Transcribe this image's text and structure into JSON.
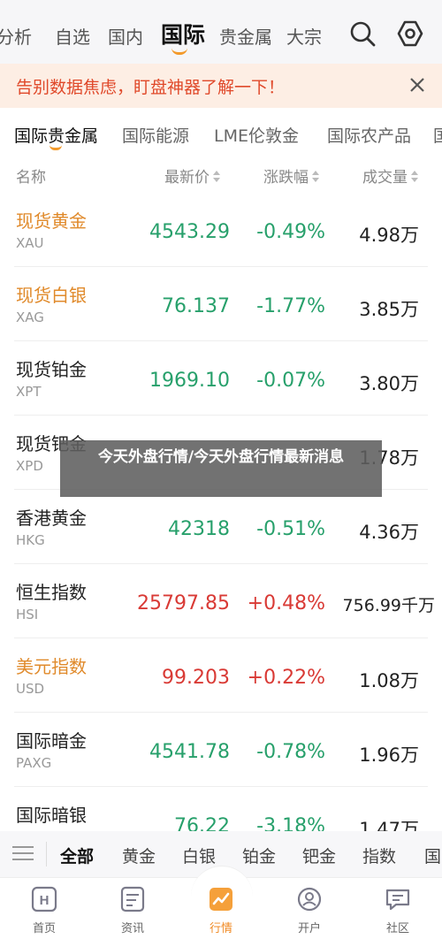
{
  "topnav": {
    "tabs": [
      "分析",
      "自选",
      "国内",
      "国际",
      "贵金属",
      "大宗"
    ],
    "active_tab": "国际",
    "accent_color": "#f39a2b"
  },
  "banner": {
    "text": "告别数据焦虑，盯盘神器了解一下！",
    "text_color": "#e0492a"
  },
  "categories": {
    "tabs": [
      "国际贵金属",
      "国际能源",
      "LME伦敦金",
      "国际农产品",
      "国"
    ],
    "active": "国际贵金属"
  },
  "columns": {
    "name": "名称",
    "price": "最新价",
    "change": "涨跌幅",
    "volume": "成交量"
  },
  "rows": [
    {
      "name": "现货黄金",
      "code": "XAU",
      "price": "4543.29",
      "change": "-0.49%",
      "volume": "4.98万",
      "name_color": "gold",
      "dir": "down"
    },
    {
      "name": "现货白银",
      "code": "XAG",
      "price": "76.137",
      "change": "-1.77%",
      "volume": "3.85万",
      "name_color": "gold",
      "dir": "down"
    },
    {
      "name": "现货铂金",
      "code": "XPT",
      "price": "1969.10",
      "change": "-0.07%",
      "volume": "3.80万",
      "name_color": "normal",
      "dir": "down"
    },
    {
      "name": "现货钯金",
      "code": "XPD",
      "price": "",
      "change": "",
      "volume": "1.78万",
      "name_color": "normal",
      "dir": "down"
    },
    {
      "name": "香港黄金",
      "code": "HKG",
      "price": "42318",
      "change": "-0.51%",
      "volume": "4.36万",
      "name_color": "normal",
      "dir": "down"
    },
    {
      "name": "恒生指数",
      "code": "HSI",
      "price": "25797.85",
      "change": "+0.48%",
      "volume": "756.99千万",
      "name_color": "normal",
      "dir": "up"
    },
    {
      "name": "美元指数",
      "code": "USD",
      "price": "99.203",
      "change": "+0.22%",
      "volume": "1.08万",
      "name_color": "gold",
      "dir": "up"
    },
    {
      "name": "国际暗金",
      "code": "PAXG",
      "price": "4541.78",
      "change": "-0.78%",
      "volume": "1.96万",
      "name_color": "normal",
      "dir": "down"
    },
    {
      "name": "国际暗银",
      "code": "",
      "price": "76.22",
      "change": "-3.18%",
      "volume": "1.47万",
      "name_color": "normal",
      "dir": "down"
    }
  ],
  "overlay": {
    "caption": "今天外盘行情/今天外盘行情最新消息"
  },
  "filters": {
    "items": [
      "全部",
      "黄金",
      "白银",
      "铂金",
      "钯金",
      "指数",
      "国"
    ],
    "active": "全部"
  },
  "tabbar": {
    "items": [
      {
        "label": "首页",
        "icon": "home-icon"
      },
      {
        "label": "资讯",
        "icon": "news-icon"
      },
      {
        "label": "行情",
        "icon": "market-icon"
      },
      {
        "label": "开户",
        "icon": "account-icon"
      },
      {
        "label": "社区",
        "icon": "community-icon"
      }
    ],
    "active": "行情"
  },
  "colors": {
    "down": "#27a06b",
    "up": "#d93a35",
    "gold_name": "#e08a2b"
  }
}
